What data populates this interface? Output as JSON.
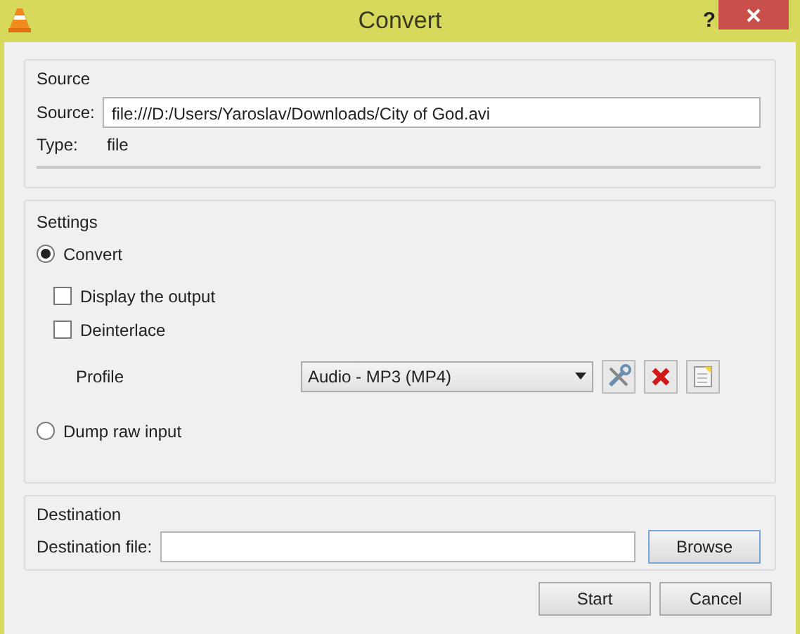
{
  "window": {
    "title": "Convert",
    "help": "?"
  },
  "source": {
    "title": "Source",
    "source_label": "Source:",
    "source_value": "file:///D:/Users/Yaroslav/Downloads/City of God.avi",
    "type_label": "Type:",
    "type_value": "file"
  },
  "settings": {
    "title": "Settings",
    "modes": [
      {
        "label": "Convert",
        "selected": true
      },
      {
        "label": "Dump raw input",
        "selected": false
      }
    ],
    "options": [
      {
        "label": "Display the output",
        "checked": false
      },
      {
        "label": "Deinterlace",
        "checked": false
      }
    ],
    "profile": {
      "label": "Profile",
      "value": "Audio - MP3 (MP4)"
    }
  },
  "destination": {
    "title": "Destination",
    "label": "Destination file:",
    "browse": "Browse"
  },
  "buttons": [
    {
      "label": "Start"
    },
    {
      "label": "Cancel"
    }
  ]
}
